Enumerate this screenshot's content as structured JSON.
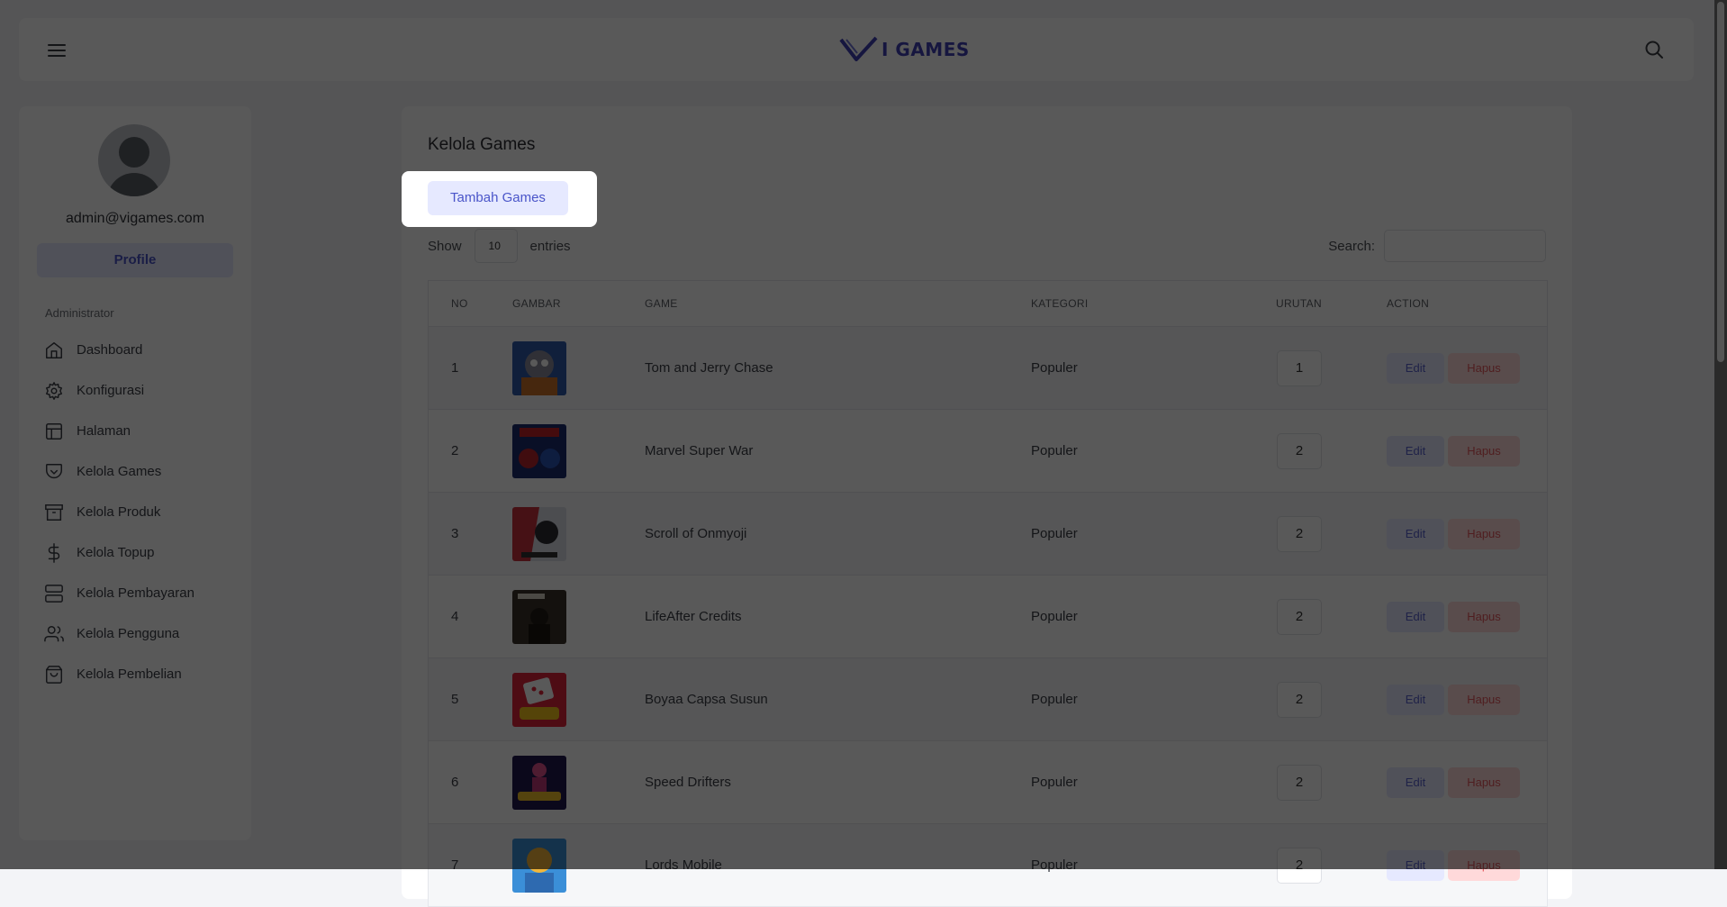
{
  "header": {
    "logo_mark": "V",
    "logo_text": "I GAMES",
    "menu_icon": "hamburger-icon",
    "search_icon": "search-icon"
  },
  "sidebar": {
    "email": "admin@vigames.com",
    "profile_label": "Profile",
    "section_label": "Administrator",
    "items": [
      {
        "label": "Dashboard",
        "icon": "home-icon"
      },
      {
        "label": "Konfigurasi",
        "icon": "gear-icon"
      },
      {
        "label": "Halaman",
        "icon": "layout-icon"
      },
      {
        "label": "Kelola Games",
        "icon": "pocket-icon"
      },
      {
        "label": "Kelola Produk",
        "icon": "archive-icon"
      },
      {
        "label": "Kelola Topup",
        "icon": "dollar-icon"
      },
      {
        "label": "Kelola Pembayaran",
        "icon": "server-icon"
      },
      {
        "label": "Kelola Pengguna",
        "icon": "users-icon"
      },
      {
        "label": "Kelola Pembelian",
        "icon": "shopping-bag-icon"
      }
    ]
  },
  "main": {
    "title": "Kelola Games",
    "add_button": "Tambah Games",
    "show_label": "Show",
    "entries_value": "10",
    "entries_label": "entries",
    "search_label": "Search:",
    "columns": [
      "NO",
      "GAMBAR",
      "GAME",
      "KATEGORI",
      "URUTAN",
      "ACTION"
    ],
    "rows": [
      {
        "no": "1",
        "game": "Tom and Jerry Chase",
        "kategori": "Populer",
        "urutan": "1"
      },
      {
        "no": "2",
        "game": "Marvel Super War",
        "kategori": "Populer",
        "urutan": "2"
      },
      {
        "no": "3",
        "game": "Scroll of Onmyoji",
        "kategori": "Populer",
        "urutan": "2"
      },
      {
        "no": "4",
        "game": "LifeAfter Credits",
        "kategori": "Populer",
        "urutan": "2"
      },
      {
        "no": "5",
        "game": "Boyaa Capsa Susun",
        "kategori": "Populer",
        "urutan": "2"
      },
      {
        "no": "6",
        "game": "Speed Drifters",
        "kategori": "Populer",
        "urutan": "2"
      },
      {
        "no": "7",
        "game": "Lords Mobile",
        "kategori": "Populer",
        "urutan": "2"
      }
    ],
    "edit_label": "Edit",
    "delete_label": "Hapus"
  },
  "colors": {
    "accent": "#4a55c9",
    "accent_bg": "#e6e9ff",
    "danger": "#e2585c",
    "danger_bg": "#ffd9da"
  }
}
